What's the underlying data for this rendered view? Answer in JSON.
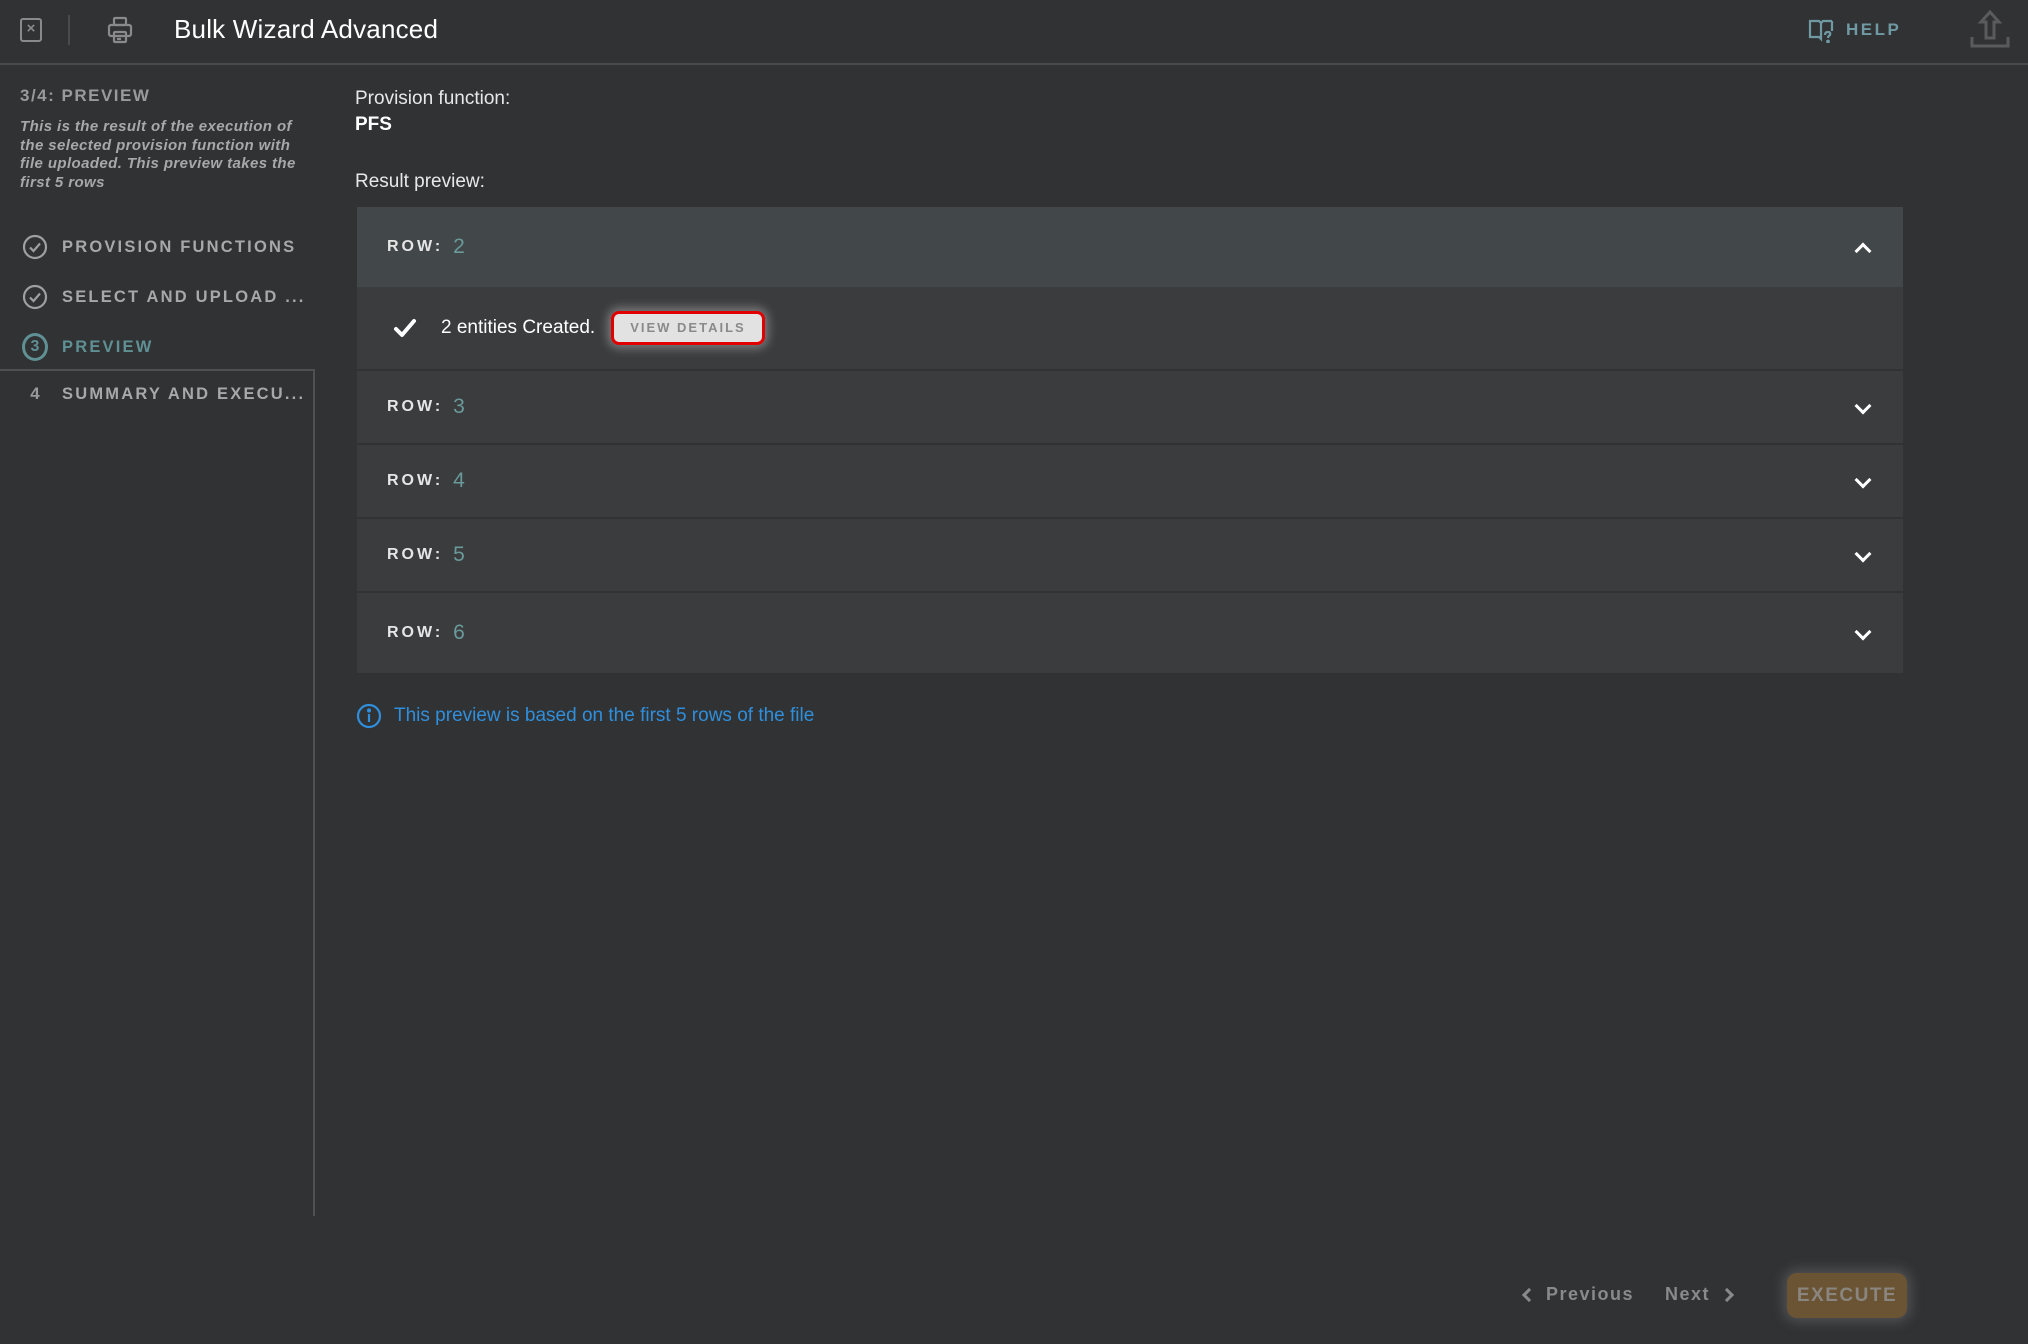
{
  "header": {
    "title": "Bulk Wizard Advanced",
    "help_label": "HELP",
    "icons": {
      "close": "close-square-icon",
      "print": "printer-icon",
      "help": "book-question-icon",
      "upload": "upload-icon"
    }
  },
  "sidebar": {
    "step_title": "3/4: PREVIEW",
    "step_description": "This is the result of the execution of the selected provision function with file uploaded. This preview takes the first 5 rows",
    "steps": [
      {
        "label": "PROVISION FUNCTIONS",
        "status": "completed",
        "icon": "check-circle-icon"
      },
      {
        "label": "SELECT AND UPLOAD ...",
        "status": "completed",
        "icon": "check-circle-icon"
      },
      {
        "label": "PREVIEW",
        "status": "active",
        "number": "3"
      },
      {
        "label": "SUMMARY AND EXECU...",
        "status": "pending",
        "number": "4"
      }
    ]
  },
  "main": {
    "provision_function_label": "Provision function:",
    "provision_function_value": "PFS",
    "result_preview_label": "Result preview:",
    "row_label": "ROW:",
    "rows": [
      {
        "number": "2",
        "expanded": true,
        "result_text": "2 entities Created.",
        "view_details_label": "VIEW DETAILS"
      },
      {
        "number": "3",
        "expanded": false
      },
      {
        "number": "4",
        "expanded": false
      },
      {
        "number": "5",
        "expanded": false
      },
      {
        "number": "6",
        "expanded": false
      }
    ],
    "info_text": "This preview is based on the first 5 rows of the file"
  },
  "footer": {
    "previous_label": "Previous",
    "next_label": "Next",
    "execute_label": "EXECUTE"
  },
  "colors": {
    "background": "#313234",
    "accent_teal": "#5f9094",
    "info_blue": "#2f8fdc",
    "execute_bg": "#6a5434",
    "highlight_red": "#e00000"
  }
}
